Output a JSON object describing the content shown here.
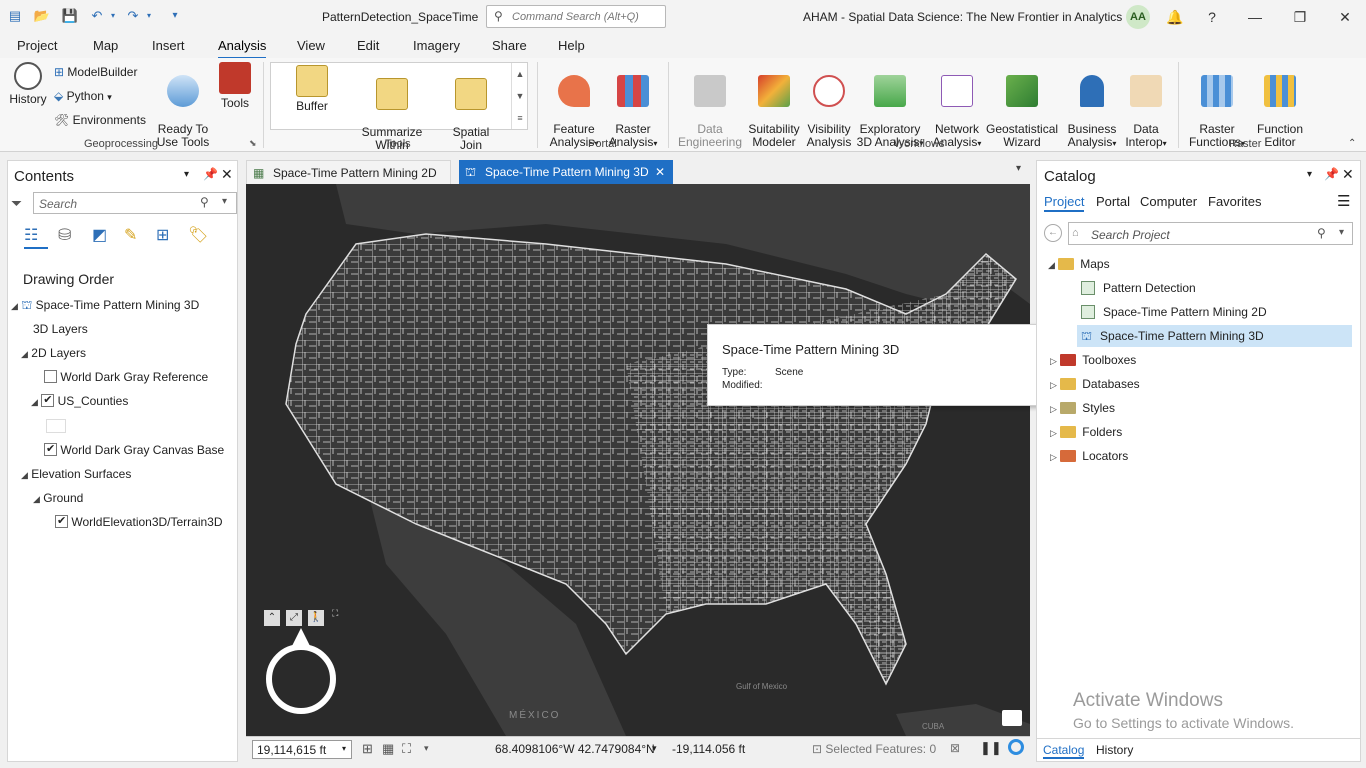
{
  "app": {
    "project_name": "PatternDetection_SpaceTime",
    "course_title": "AHAM - Spatial Data Science:  The New Frontier in Analytics",
    "user_initials": "AA",
    "command_search_placeholder": "Command Search (Alt+Q)"
  },
  "menu": [
    "Project",
    "Map",
    "Insert",
    "Analysis",
    "View",
    "Edit",
    "Imagery",
    "Share",
    "Help"
  ],
  "ribbon": {
    "geoprocessing": {
      "label": "Geoprocessing",
      "history": "History",
      "modelbuilder": "ModelBuilder",
      "python": "Python",
      "environments": "Environments",
      "ready_to_use": "Ready To\nUse Tools",
      "tools": "Tools"
    },
    "tools": {
      "label": "Tools",
      "buffer": "Buffer",
      "summarize_within": "Summarize\nWithin",
      "spatial_join": "Spatial\nJoin"
    },
    "portal": {
      "label": "Portal",
      "feature_analysis": "Feature\nAnalysis",
      "raster_analysis": "Raster\nAnalysis"
    },
    "workflows": {
      "label": "Workflows",
      "data_engineering": "Data\nEngineering",
      "suitability_modeler": "Suitability\nModeler",
      "visibility_analysis": "Visibility\nAnalysis",
      "exploratory_3d": "Exploratory\n3D Analysis",
      "network_analysis": "Network\nAnalysis",
      "geostatistical_wizard": "Geostatistical\nWizard",
      "business_analysis": "Business\nAnalysis",
      "data_interop": "Data\nInterop"
    },
    "raster": {
      "label": "Raster",
      "raster_functions": "Raster\nFunctions",
      "function_editor": "Function\nEditor"
    }
  },
  "contents": {
    "title": "Contents",
    "search_placeholder": "Search",
    "drawing_order": "Drawing Order",
    "scene_name": "Space-Time Pattern Mining 3D",
    "layers_3d": "3D Layers",
    "layers_2d": "2D Layers",
    "world_dark_gray_reference": "World Dark Gray Reference",
    "us_counties": "US_Counties",
    "world_dark_gray_base": "World Dark Gray Canvas Base",
    "elevation_surfaces": "Elevation Surfaces",
    "ground": "Ground",
    "world_elevation": "WorldElevation3D/Terrain3D"
  },
  "tabs": {
    "tab_2d": "Space-Time Pattern Mining 2D",
    "tab_3d": "Space-Time Pattern Mining 3D"
  },
  "map": {
    "label_mexico": "MÉXICO",
    "label_gulf": "Gulf\nof\nMexico",
    "label_cuba": "CUBA"
  },
  "tooltip": {
    "title": "Space-Time Pattern Mining 3D",
    "type_label": "Type:",
    "type_value": "Scene",
    "modified_label": "Modified:"
  },
  "status": {
    "scale": "19,114,615 ft",
    "coordinates": "68.4098106°W 42.7479084°N",
    "elevation": "-19,114.056 ft",
    "selected_features": "Selected Features: 0"
  },
  "catalog": {
    "title": "Catalog",
    "tabs": [
      "Project",
      "Portal",
      "Computer",
      "Favorites"
    ],
    "search_placeholder": "Search Project",
    "maps": "Maps",
    "map_items": [
      "Pattern Detection",
      "Space-Time Pattern Mining 2D",
      "Space-Time Pattern Mining 3D"
    ],
    "toolboxes": "Toolboxes",
    "databases": "Databases",
    "styles": "Styles",
    "folders": "Folders",
    "locators": "Locators",
    "bottom_tab_catalog": "Catalog",
    "bottom_tab_history": "History"
  },
  "watermark": {
    "line1": "Activate Windows",
    "line2": "Go to Settings to activate Windows."
  },
  "colors": {
    "accent": "#1f6fc5",
    "map_background": "#2a2a2a",
    "land": "#3a3a3a",
    "boundaries": "#d8d8d8",
    "selected_row": "#cce4f7"
  }
}
